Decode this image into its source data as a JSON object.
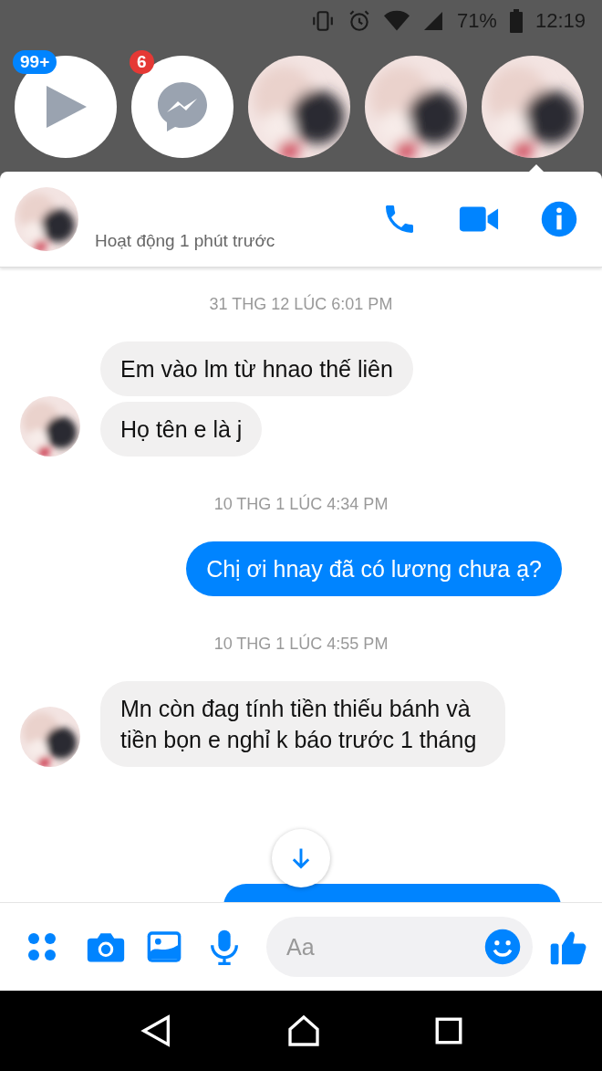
{
  "status_bar": {
    "battery": "71%",
    "time": "12:19"
  },
  "chat_heads": [
    {
      "kind": "video",
      "badge": "99+"
    },
    {
      "kind": "messenger",
      "badge": "6"
    },
    {
      "kind": "picture"
    },
    {
      "kind": "picture"
    },
    {
      "kind": "picture"
    }
  ],
  "conversation": {
    "status": "Hoạt động 1 phút trước"
  },
  "messages": [
    {
      "kind": "timestamp",
      "text": "31 THG 12 LÚC 6:01 PM"
    },
    {
      "kind": "incoming",
      "bubbles": [
        "Em vào lm từ hnao thế liên",
        "Họ tên e là j"
      ]
    },
    {
      "kind": "timestamp",
      "text": "10 THG 1 LÚC 4:34 PM"
    },
    {
      "kind": "outgoing",
      "bubbles": [
        "Chị ơi hnay đã có lương chưa ạ?"
      ]
    },
    {
      "kind": "timestamp",
      "text": "10 THG 1 LÚC 4:55 PM"
    },
    {
      "kind": "incoming",
      "bubbles": [
        "Mn còn đag tính tiền thiếu bánh và tiền bọn e nghỉ k báo trước 1 tháng"
      ]
    }
  ],
  "composer": {
    "placeholder": "Aa"
  }
}
